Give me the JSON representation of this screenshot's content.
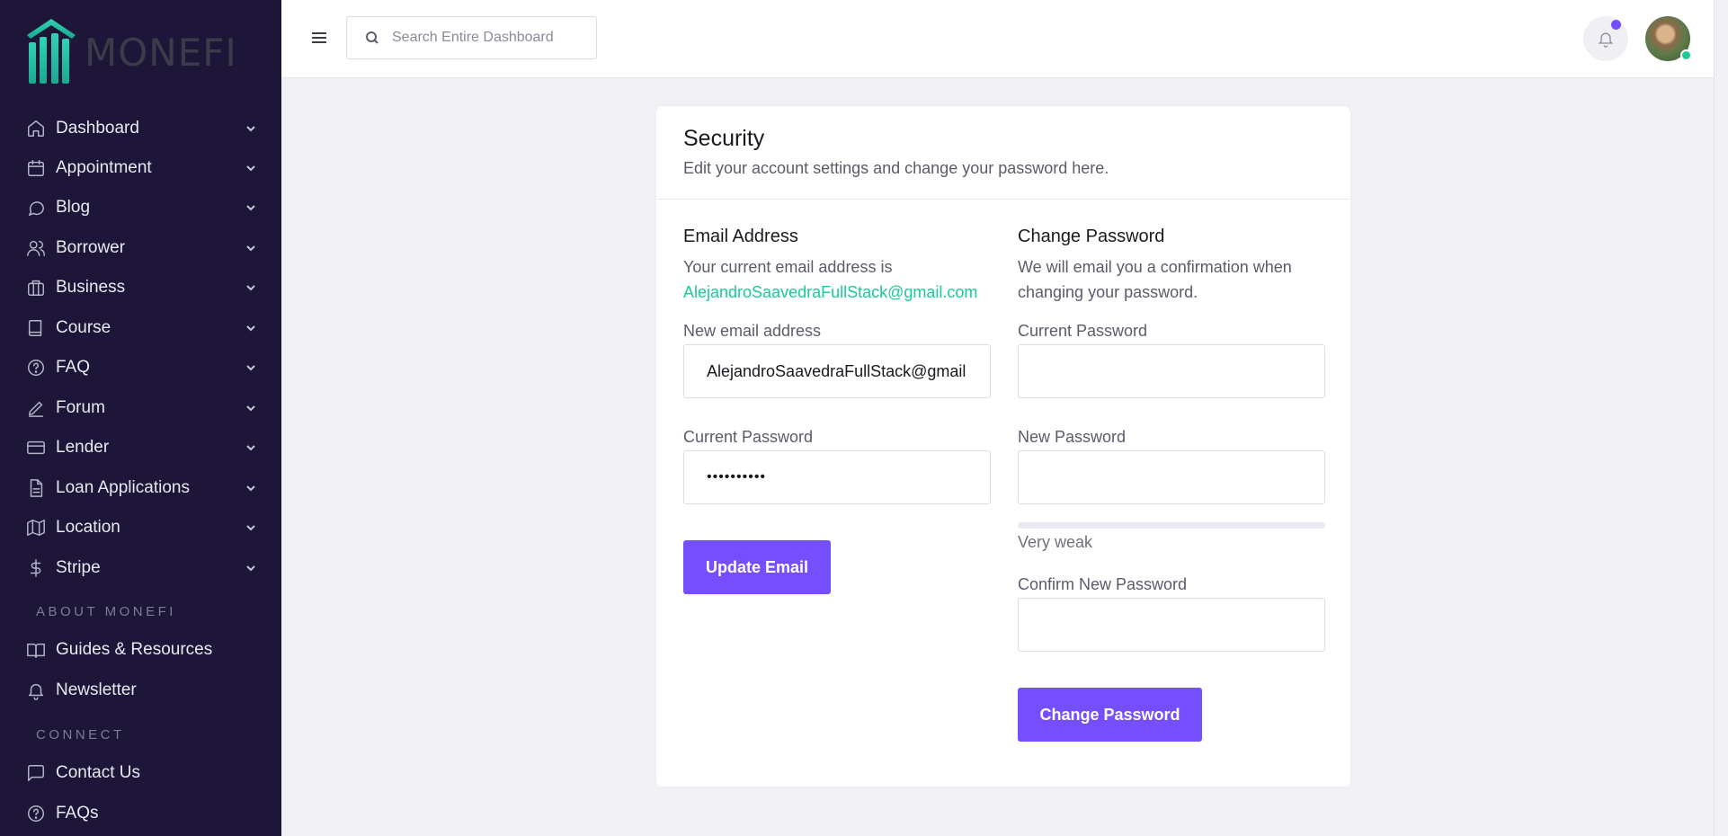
{
  "brand": {
    "name": "MONEFI"
  },
  "sidebar": {
    "items": [
      {
        "label": "Dashboard",
        "icon": "home-icon"
      },
      {
        "label": "Appointment",
        "icon": "calendar-icon"
      },
      {
        "label": "Blog",
        "icon": "chat-bubble-icon"
      },
      {
        "label": "Borrower",
        "icon": "users-icon"
      },
      {
        "label": "Business",
        "icon": "briefcase-icon"
      },
      {
        "label": "Course",
        "icon": "book-icon"
      },
      {
        "label": "FAQ",
        "icon": "help-circle-icon"
      },
      {
        "label": "Forum",
        "icon": "pen-icon"
      },
      {
        "label": "Lender",
        "icon": "credit-card-icon"
      },
      {
        "label": "Loan Applications",
        "icon": "file-text-icon"
      },
      {
        "label": "Location",
        "icon": "map-icon"
      },
      {
        "label": "Stripe",
        "icon": "dollar-sign-icon"
      }
    ],
    "section_about": "ABOUT MONEFI",
    "about_items": [
      {
        "label": "Guides & Resources",
        "icon": "book-open-icon"
      },
      {
        "label": "Newsletter",
        "icon": "bell-icon"
      }
    ],
    "section_connect": "CONNECT",
    "connect_items": [
      {
        "label": "Contact Us",
        "icon": "message-square-icon"
      },
      {
        "label": "FAQs",
        "icon": "help-circle-icon"
      }
    ]
  },
  "topbar": {
    "search_placeholder": "Search Entire Dashboard"
  },
  "security": {
    "title": "Security",
    "subtitle": "Edit your account settings and change your password here.",
    "email_section": {
      "title": "Email Address",
      "desc_prefix": "Your current email address is",
      "current_email": "AlejandroSaavedraFullStack@gmail.com",
      "new_email_label": "New email address",
      "new_email_value": "AlejandroSaavedraFullStack@gmail",
      "current_password_label": "Current Password",
      "current_password_masked": "••••••••••",
      "button": "Update Email"
    },
    "password_section": {
      "title": "Change Password",
      "desc": "We will email you a confirmation when changing your password.",
      "current_password_label": "Current Password",
      "new_password_label": "New Password",
      "strength_label": "Very weak",
      "strength_fraction": 0,
      "confirm_password_label": "Confirm New Password",
      "button": "Change Password"
    }
  },
  "colors": {
    "sidebar_bg": "#1e1638",
    "accent": "#754ffe",
    "success": "#19cb98",
    "page_bg": "#f1f1f5"
  }
}
